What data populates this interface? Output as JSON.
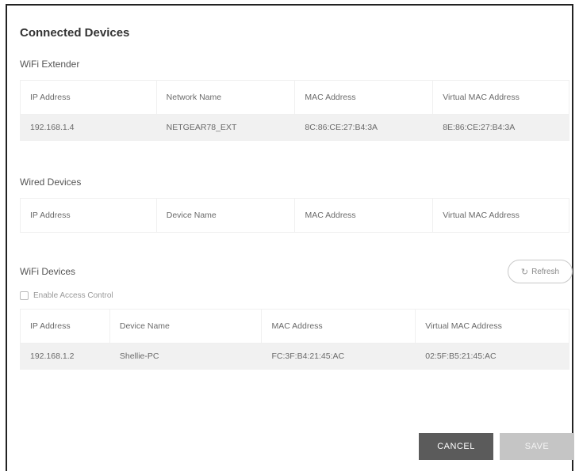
{
  "page": {
    "title": "Connected Devices"
  },
  "wifi_extender": {
    "label": "WiFi Extender",
    "columns": [
      "IP Address",
      "Network Name",
      "MAC Address",
      "Virtual MAC Address"
    ],
    "rows": [
      [
        "192.168.1.4",
        "NETGEAR78_EXT",
        "8C:86:CE:27:B4:3A",
        "8E:86:CE:27:B4:3A"
      ]
    ]
  },
  "wired_devices": {
    "label": "Wired Devices",
    "columns": [
      "IP Address",
      "Device Name",
      "MAC Address",
      "Virtual MAC Address"
    ]
  },
  "wifi_devices": {
    "label": "WiFi Devices",
    "refresh_label": "Refresh",
    "access_control_label": "Enable Access Control",
    "columns": [
      "IP Address",
      "Device Name",
      "MAC Address",
      "Virtual MAC Address"
    ],
    "rows": [
      [
        "192.168.1.2",
        "Shellie-PC",
        "FC:3F:B4:21:45:AC",
        "02:5F:B5:21:45:AC"
      ]
    ]
  },
  "actions": {
    "cancel_label": "CANCEL",
    "save_label": "SAVE"
  },
  "icons": {
    "refresh": "refresh-icon"
  }
}
